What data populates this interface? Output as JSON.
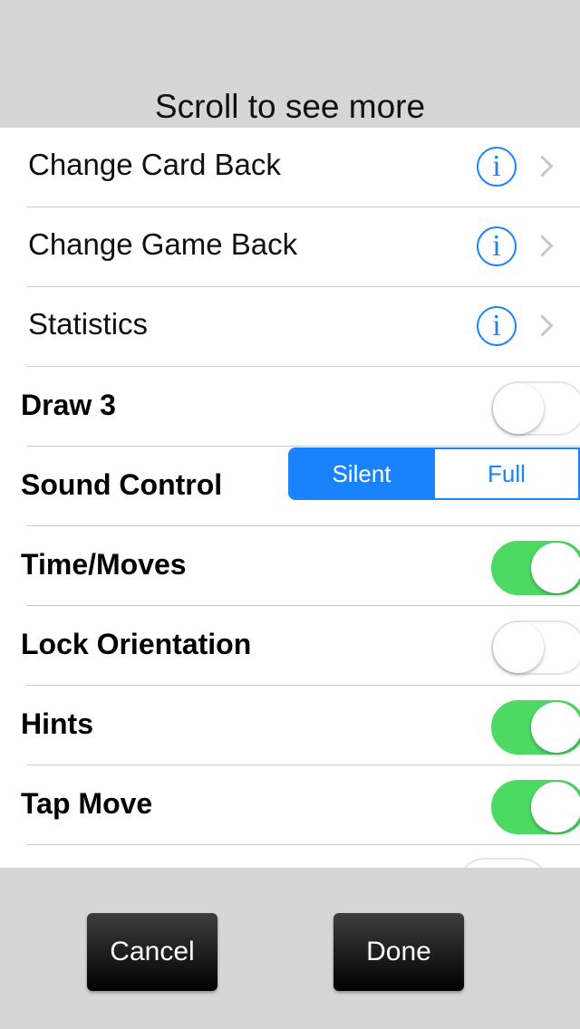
{
  "header": {
    "title": "Scroll to see more"
  },
  "nav_rows": [
    {
      "label": "Change Card Back"
    },
    {
      "label": "Change Game Back"
    },
    {
      "label": "Statistics"
    }
  ],
  "info_glyph": "i",
  "settings": {
    "draw3": {
      "label": "Draw 3",
      "on": false
    },
    "sound": {
      "label": "Sound Control",
      "options": [
        "Silent",
        "Full"
      ],
      "selected": "Silent"
    },
    "time_moves": {
      "label": "Time/Moves",
      "on": true
    },
    "lock_orientation": {
      "label": "Lock Orientation",
      "on": false
    },
    "hints": {
      "label": "Hints",
      "on": true
    },
    "tap_move": {
      "label": "Tap Move",
      "on": true
    }
  },
  "buttons": {
    "cancel": "Cancel",
    "done": "Done"
  },
  "colors": {
    "accent": "#1a82fb",
    "toggle_on": "#4cd964",
    "background": "#d6d6d6"
  }
}
